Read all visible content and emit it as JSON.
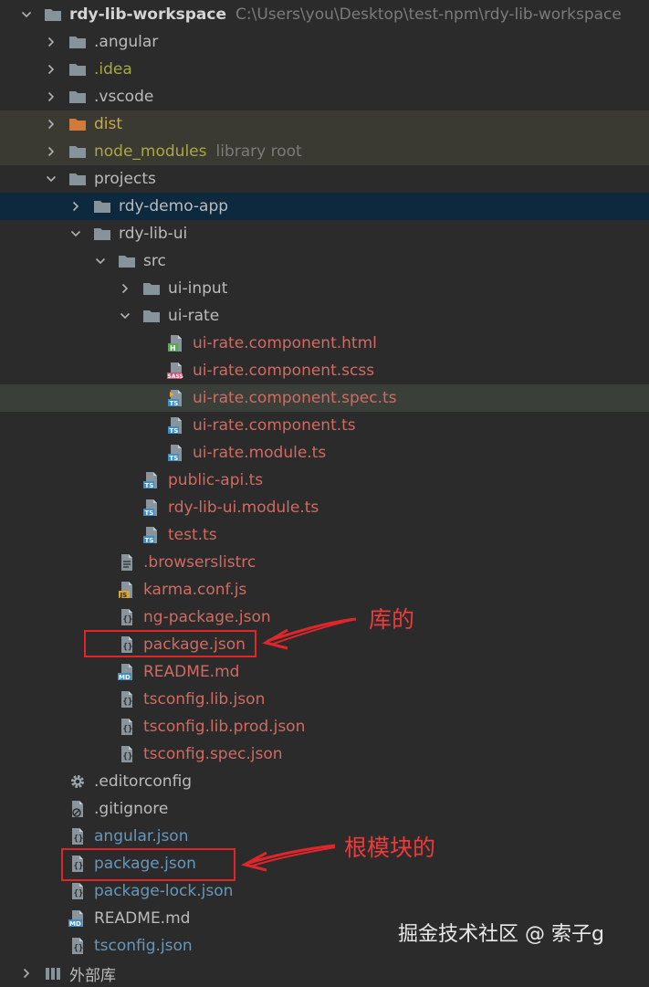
{
  "project": {
    "name": "rdy-lib-workspace",
    "path": "C:\\Users\\you\\Desktop\\test-npm\\rdy-lib-workspace"
  },
  "tree": [
    {
      "label": "rdy-lib-workspace",
      "hint": "C:\\Users\\you\\Desktop\\test-npm\\rdy-lib-workspace",
      "depth": 0,
      "arrow": "down",
      "icon": "folder-icon",
      "style": "root",
      "row": ""
    },
    {
      "label": ".angular",
      "depth": 1,
      "arrow": "right",
      "icon": "folder-icon",
      "style": "normal",
      "row": ""
    },
    {
      "label": ".idea",
      "depth": 1,
      "arrow": "right",
      "icon": "folder-icon",
      "style": "ignored",
      "row": ""
    },
    {
      "label": ".vscode",
      "depth": 1,
      "arrow": "right",
      "icon": "folder-icon",
      "style": "normal",
      "row": ""
    },
    {
      "label": "dist",
      "depth": 1,
      "arrow": "right",
      "icon": "excluded-folder-icon",
      "style": "excl",
      "row": "ign"
    },
    {
      "label": "node_modules",
      "hint": "library root",
      "depth": 1,
      "arrow": "right",
      "icon": "folder-icon",
      "style": "ignored",
      "row": "lib"
    },
    {
      "label": "projects",
      "depth": 1,
      "arrow": "down",
      "icon": "folder-icon",
      "style": "normal",
      "row": ""
    },
    {
      "label": "rdy-demo-app",
      "depth": 2,
      "arrow": "right",
      "icon": "folder-icon",
      "style": "normal",
      "row": "sel"
    },
    {
      "label": "rdy-lib-ui",
      "depth": 2,
      "arrow": "down",
      "icon": "folder-icon",
      "style": "normal",
      "row": ""
    },
    {
      "label": "src",
      "depth": 3,
      "arrow": "down",
      "icon": "folder-icon",
      "style": "normal",
      "row": ""
    },
    {
      "label": "ui-input",
      "depth": 4,
      "arrow": "right",
      "icon": "folder-icon",
      "style": "normal",
      "row": ""
    },
    {
      "label": "ui-rate",
      "depth": 4,
      "arrow": "down",
      "icon": "folder-icon",
      "style": "normal",
      "row": ""
    },
    {
      "label": "ui-rate.component.html",
      "depth": 5,
      "arrow": "",
      "icon": "html-file-icon",
      "style": "modified",
      "row": ""
    },
    {
      "label": "ui-rate.component.scss",
      "depth": 5,
      "arrow": "",
      "icon": "sass-file-icon",
      "style": "modified",
      "row": ""
    },
    {
      "label": "ui-rate.component.spec.ts",
      "depth": 5,
      "arrow": "",
      "icon": "ts-test-file-icon",
      "style": "modified",
      "row": "hl"
    },
    {
      "label": "ui-rate.component.ts",
      "depth": 5,
      "arrow": "",
      "icon": "ts-file-icon",
      "style": "modified",
      "row": ""
    },
    {
      "label": "ui-rate.module.ts",
      "depth": 5,
      "arrow": "",
      "icon": "ts-file-icon",
      "style": "modified",
      "row": ""
    },
    {
      "label": "public-api.ts",
      "depth": 4,
      "arrow": "",
      "icon": "ts-file-icon",
      "style": "modified",
      "row": ""
    },
    {
      "label": "rdy-lib-ui.module.ts",
      "depth": 4,
      "arrow": "",
      "icon": "ts-file-icon",
      "style": "modified",
      "row": ""
    },
    {
      "label": "test.ts",
      "depth": 4,
      "arrow": "",
      "icon": "ts-file-icon",
      "style": "modified",
      "row": ""
    },
    {
      "label": ".browserslistrc",
      "depth": 3,
      "arrow": "",
      "icon": "text-file-icon",
      "style": "modified",
      "row": ""
    },
    {
      "label": "karma.conf.js",
      "depth": 3,
      "arrow": "",
      "icon": "js-file-icon",
      "style": "modified",
      "row": ""
    },
    {
      "label": "ng-package.json",
      "depth": 3,
      "arrow": "",
      "icon": "json-file-icon",
      "style": "modified",
      "row": ""
    },
    {
      "label": "package.json",
      "depth": 3,
      "arrow": "",
      "icon": "json-file-icon",
      "style": "modified",
      "row": ""
    },
    {
      "label": "README.md",
      "depth": 3,
      "arrow": "",
      "icon": "md-file-icon",
      "style": "modified",
      "row": ""
    },
    {
      "label": "tsconfig.lib.json",
      "depth": 3,
      "arrow": "",
      "icon": "json-file-icon",
      "style": "modified",
      "row": ""
    },
    {
      "label": "tsconfig.lib.prod.json",
      "depth": 3,
      "arrow": "",
      "icon": "json-file-icon",
      "style": "modified",
      "row": ""
    },
    {
      "label": "tsconfig.spec.json",
      "depth": 3,
      "arrow": "",
      "icon": "json-file-icon",
      "style": "modified",
      "row": ""
    },
    {
      "label": ".editorconfig",
      "depth": 1,
      "arrow": "",
      "icon": "gear-icon",
      "style": "normal",
      "row": ""
    },
    {
      "label": ".gitignore",
      "depth": 1,
      "arrow": "",
      "icon": "ignore-file-icon",
      "style": "normal",
      "row": ""
    },
    {
      "label": "angular.json",
      "depth": 1,
      "arrow": "",
      "icon": "json-file-icon",
      "style": "changed",
      "row": ""
    },
    {
      "label": "package.json",
      "depth": 1,
      "arrow": "",
      "icon": "json-file-icon",
      "style": "changed",
      "row": ""
    },
    {
      "label": "package-lock.json",
      "depth": 1,
      "arrow": "",
      "icon": "json-file-icon",
      "style": "changed",
      "row": ""
    },
    {
      "label": "README.md",
      "depth": 1,
      "arrow": "",
      "icon": "md-file-icon",
      "style": "normal",
      "row": ""
    },
    {
      "label": "tsconfig.json",
      "depth": 1,
      "arrow": "",
      "icon": "json-file-icon",
      "style": "changed",
      "row": ""
    },
    {
      "label": "外部库",
      "depth": 0,
      "arrow": "right",
      "icon": "library-icon",
      "style": "normal",
      "row": ""
    }
  ],
  "annotations": {
    "lib_label": "库的",
    "root_label": "根模块的"
  },
  "watermark": "掘金技术社区 @ 索子g",
  "colors": {
    "background": "#2b2b2b",
    "selected_row": "#0d293e",
    "modified_text": "#d06b62",
    "changed_text": "#6897bb",
    "ignored_text": "#a8a845",
    "annotation_red": "#e0262a"
  }
}
